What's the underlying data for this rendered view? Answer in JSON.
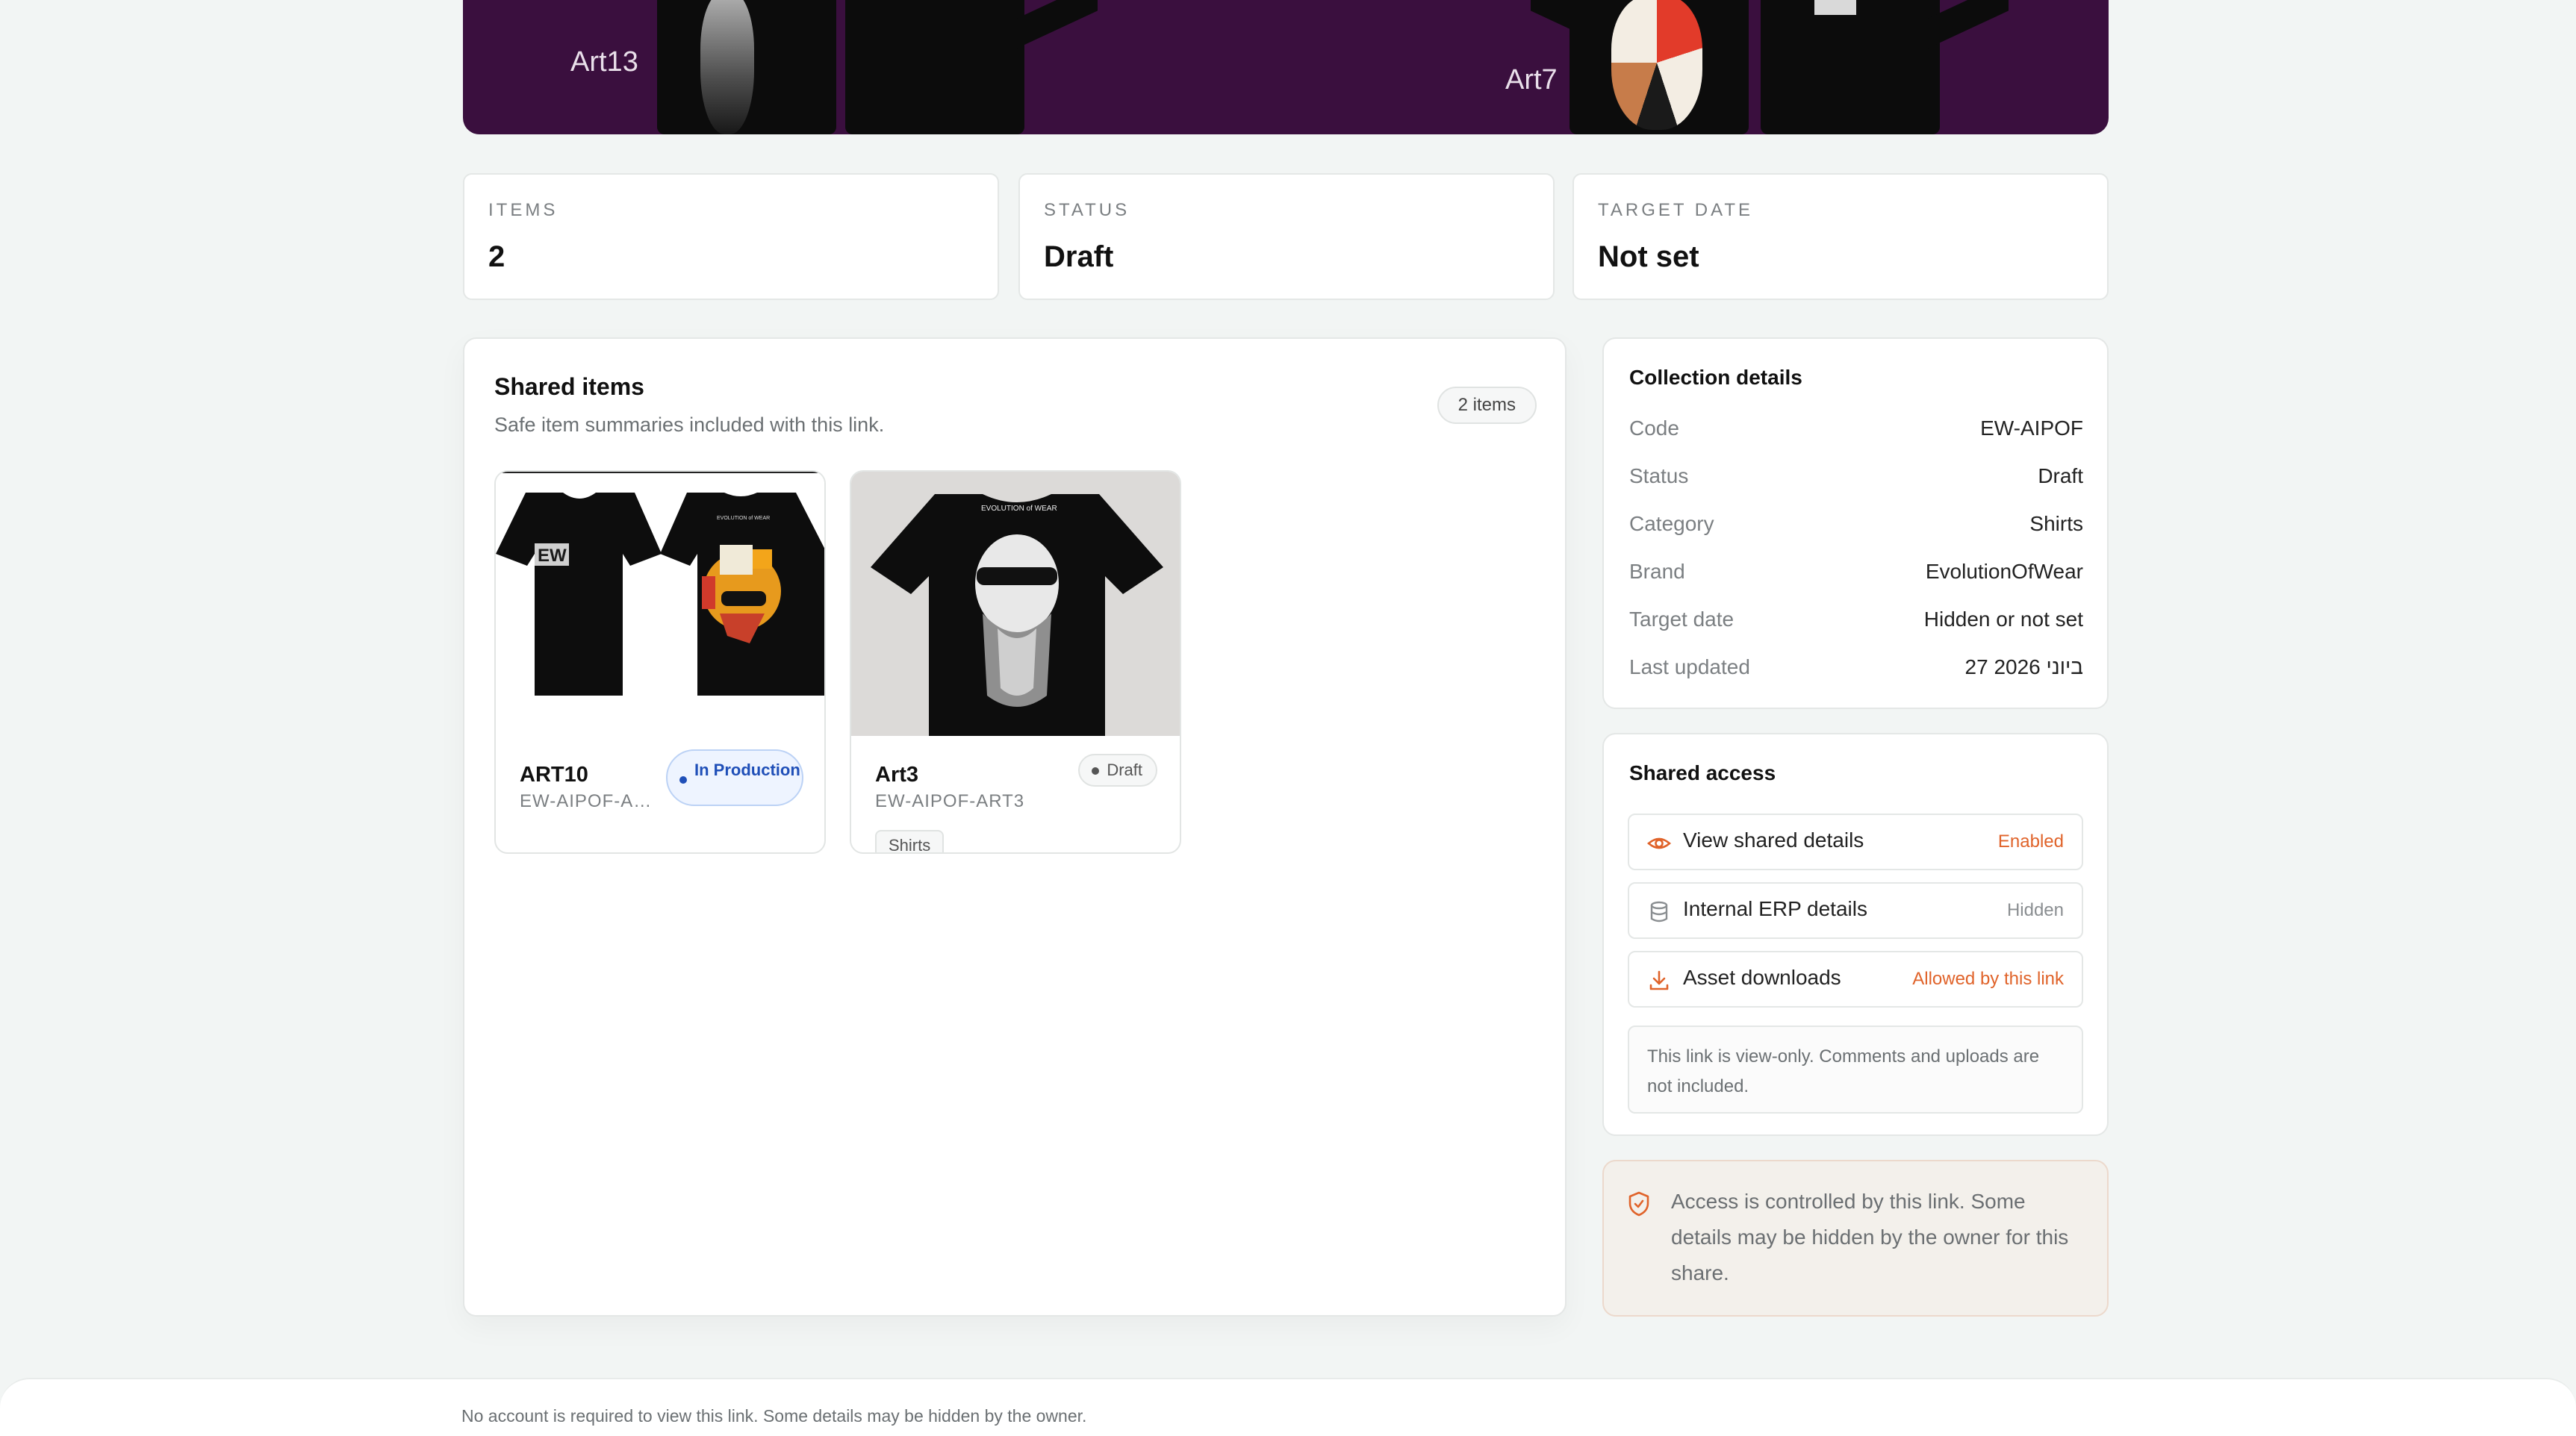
{
  "hero": {
    "labels": [
      "Art13",
      "Art7"
    ],
    "background": "#3a0f3e"
  },
  "stats": [
    {
      "label": "ITEMS",
      "value": "2"
    },
    {
      "label": "STATUS",
      "value": "Draft"
    },
    {
      "label": "TARGET DATE",
      "value": "Not set"
    }
  ],
  "shared_items": {
    "title": "Shared items",
    "subtitle": "Safe item summaries included with this link.",
    "count": "2 items",
    "items": [
      {
        "name": "ART10",
        "code": "EW-AIPOF-AR...",
        "status": "In Production",
        "image_text": "EVOLUTION of WEAR"
      },
      {
        "name": "Art3",
        "code": "EW-AIPOF-ART3",
        "status": "Draft",
        "tag": "Shirts",
        "image_text": "EVOLUTION of WEAR"
      }
    ]
  },
  "collection_details": {
    "title": "Collection details",
    "rows": [
      {
        "key": "Code",
        "value": "EW-AIPOF"
      },
      {
        "key": "Status",
        "value": "Draft"
      },
      {
        "key": "Category",
        "value": "Shirts"
      },
      {
        "key": "Brand",
        "value": "EvolutionOfWear"
      },
      {
        "key": "Target date",
        "value": "Hidden or not set"
      },
      {
        "key": "Last updated",
        "value": "27 ביוני 2026"
      }
    ]
  },
  "shared_access": {
    "title": "Shared access",
    "rows": [
      {
        "label": "View shared details",
        "value": "Enabled",
        "icon": "eye-icon",
        "color": "#e0632a"
      },
      {
        "label": "Internal ERP details",
        "value": "Hidden",
        "icon": "database-icon",
        "color": "#8a8e91"
      },
      {
        "label": "Asset downloads",
        "value": "Allowed by this link",
        "icon": "download-icon",
        "color": "#e0632a"
      }
    ],
    "note": "This link is view-only. Comments and uploads are not included."
  },
  "notice": {
    "text": "Access is controlled by this link. Some details may be hidden by the owner for this share.",
    "icon": "shield-icon"
  },
  "footer": {
    "text": "No account is required to view this link. Some details may be hidden by the owner."
  },
  "colors": {
    "accent": "#e0632a",
    "production_blue": "#1f4fb8"
  }
}
